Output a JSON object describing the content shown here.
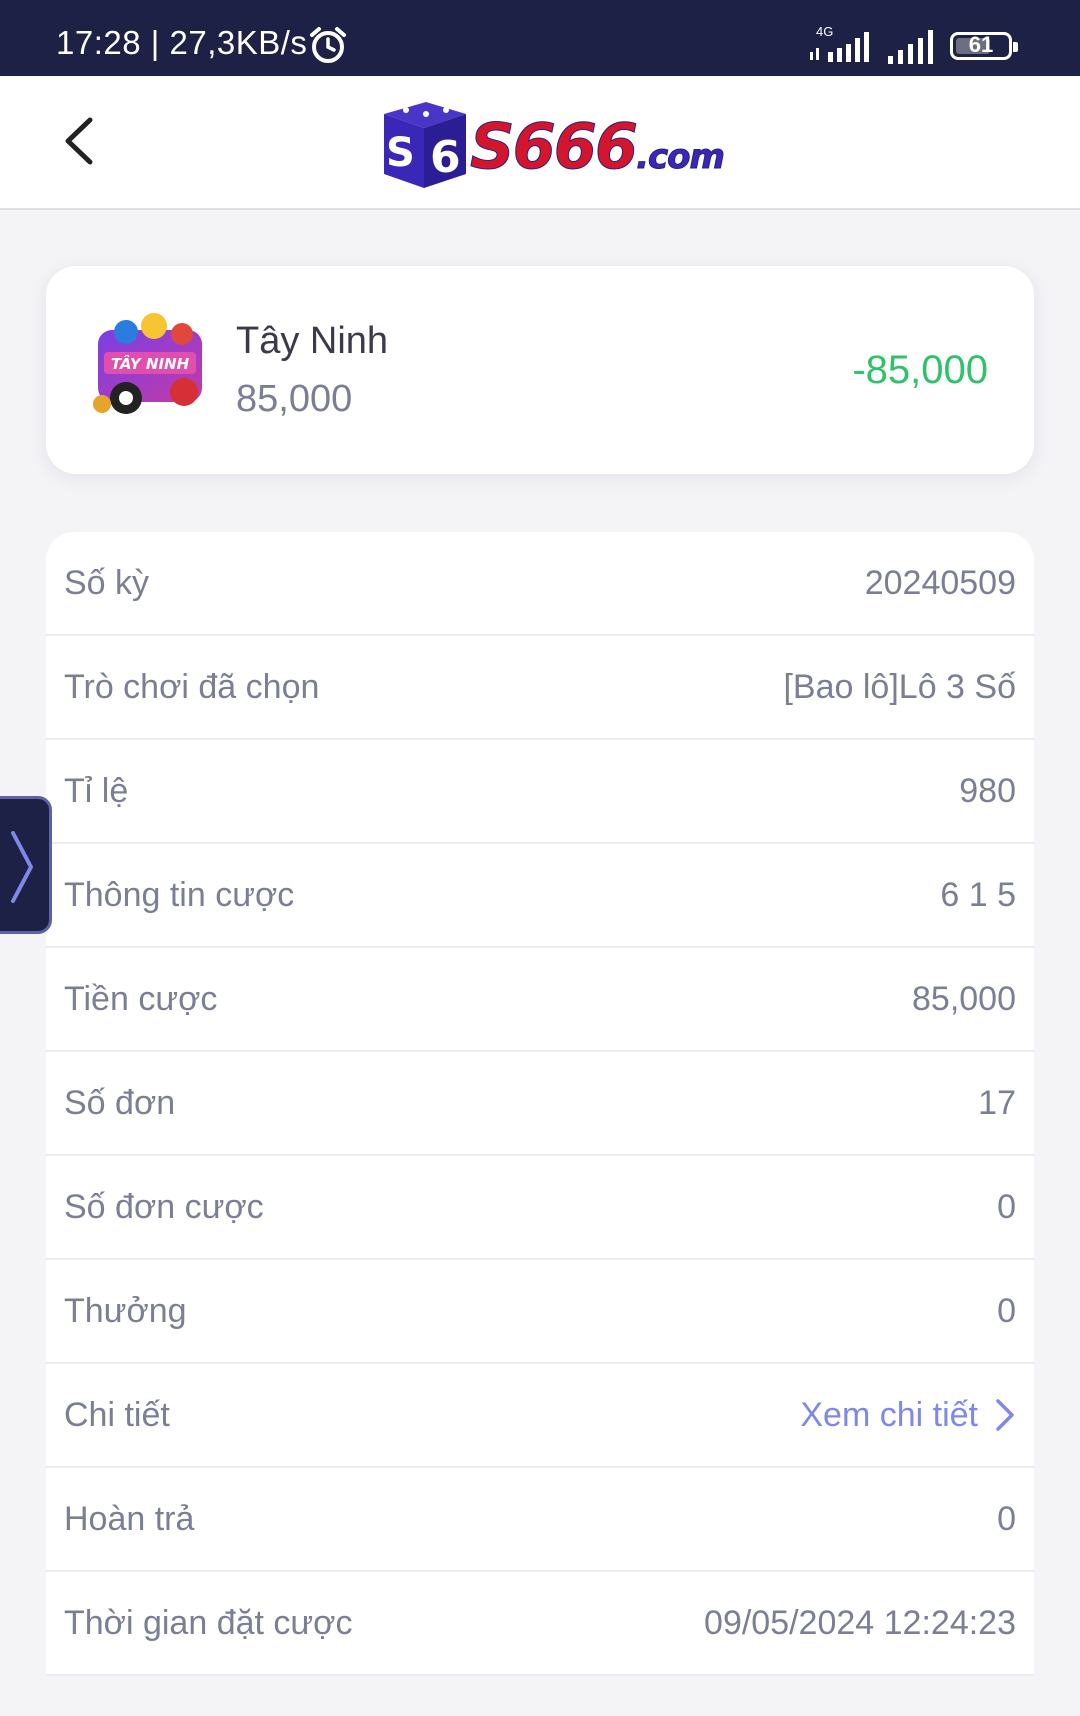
{
  "status_bar": {
    "time_speed": "17:28 | 27,3KB/s",
    "network_label": "4G",
    "battery_level": "61"
  },
  "header": {
    "logo_text_prefix": "S666",
    "logo_text_suffix": ".com",
    "logo_badge": "6"
  },
  "game": {
    "icon_text": "TÂY NINH",
    "name": "Tây Ninh",
    "stake": "85,000",
    "result": "-85,000",
    "result_color": "#2ec36b"
  },
  "details": {
    "rows": [
      {
        "label": "Số kỳ",
        "value": "20240509"
      },
      {
        "label": "Trò chơi đã chọn",
        "value": "[Bao lô]Lô 3 Số"
      },
      {
        "label": "Tỉ lệ",
        "value": "980"
      },
      {
        "label": "Thông tin cược",
        "value": "6 1 5"
      },
      {
        "label": "Tiền cược",
        "value": "85,000"
      },
      {
        "label": "Số đơn",
        "value": "17"
      },
      {
        "label": "Số đơn cược",
        "value": "0"
      },
      {
        "label": "Thưởng",
        "value": "0"
      },
      {
        "label": "Chi tiết",
        "value": "Xem chi tiết"
      },
      {
        "label": "Hoàn trả",
        "value": "0"
      },
      {
        "label": "Thời gian đặt cược",
        "value": "09/05/2024 12:24:23"
      }
    ]
  },
  "colors": {
    "status_bar_bg": "#1c2145",
    "link": "#7f88ea",
    "text_muted": "#7b7f94"
  }
}
